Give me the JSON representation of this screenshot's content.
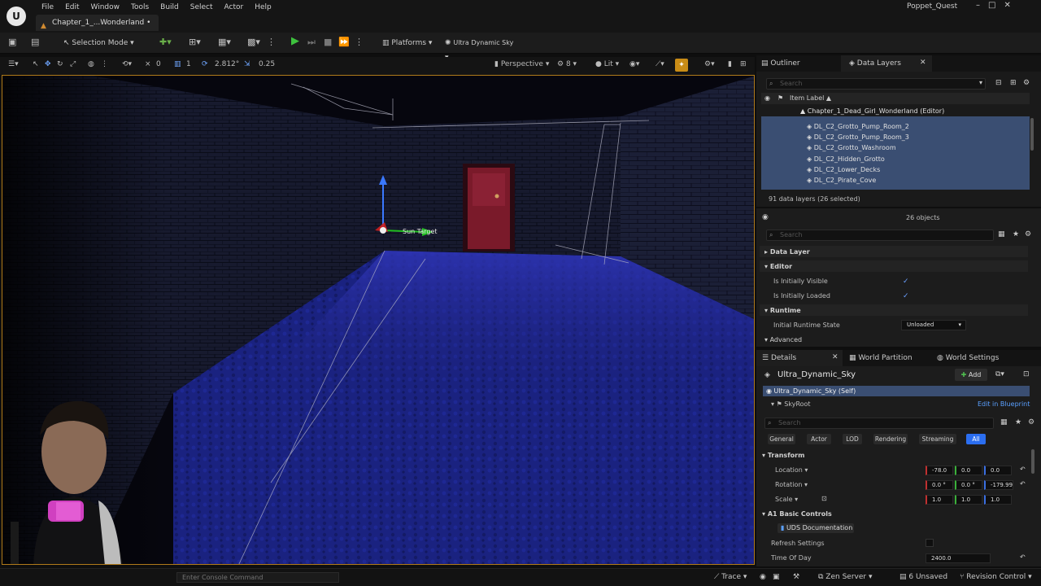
{
  "titlebar": {
    "menu": [
      "File",
      "Edit",
      "Window",
      "Tools",
      "Build",
      "Select",
      "Actor",
      "Help"
    ],
    "doc_tab": "Chapter_1_...Wonderland •",
    "project": "Poppet_Quest",
    "logo": "U",
    "window_controls": [
      "–",
      "□",
      "✕"
    ]
  },
  "toolbar": {
    "mode": "Selection Mode",
    "platforms": "Platforms",
    "sky": "Ultra Dynamic Sky"
  },
  "viewport_toolbar": {
    "grid_angle": "0",
    "grid_snap": "1",
    "move_speed": "2.812°",
    "scale_snap": "0.25",
    "view": "Perspective",
    "fov": "8",
    "lit": "Lit"
  },
  "viewport": {
    "gizmo_label": "Sun Target",
    "accent_border": "#b07a1a"
  },
  "console": {
    "placeholder": "Enter Console Command",
    "trace": "Trace",
    "zen": "Zen Server",
    "unsaved": "6 Unsaved",
    "revision": "Revision Control"
  },
  "data_layers": {
    "tab_outliner": "Outliner",
    "tab_layers": "Data Layers",
    "search_placeholder": "Search",
    "header": "Item Label ▲",
    "root": "Chapter_1_Dead_Girl_Wonderland (Editor)",
    "items": [
      "DL_C2_Grotto_Pump_Room_2",
      "DL_C2_Grotto_Pump_Room_3",
      "DL_C2_Grotto_Washroom",
      "DL_C2_Hidden_Grotto",
      "DL_C2_Lower_Decks",
      "DL_C2_Pirate_Cove"
    ],
    "summary": "91 data layers (26 selected)"
  },
  "layer_details": {
    "count": "26 objects",
    "search_placeholder": "Search",
    "sections": {
      "data_layer": "Data Layer",
      "editor": "Editor",
      "runtime": "Runtime",
      "advanced": "Advanced"
    },
    "initially_visible": "Is Initially Visible",
    "initially_loaded": "Is Initially Loaded",
    "runtime_state_label": "Initial Runtime State",
    "runtime_state_value": "Unloaded"
  },
  "details": {
    "tab_details": "Details",
    "tab_partition": "World Partition",
    "tab_settings": "World Settings",
    "actor_name": "Ultra_Dynamic_Sky",
    "add_label": "Add",
    "self_row": "Ultra_Dynamic_Sky (Self)",
    "sky_root": "SkyRoot",
    "edit_bp": "Edit in Blueprint",
    "search_placeholder": "Search",
    "categories": [
      "General",
      "Actor",
      "LOD",
      "Rendering",
      "Streaming",
      "All"
    ],
    "transform": "Transform",
    "location_label": "Location",
    "location": [
      "-78.0",
      "0.0",
      "0.0"
    ],
    "rotation_label": "Rotation",
    "rotation": [
      "0.0 °",
      "0.0 °",
      "-179.99"
    ],
    "scale_label": "Scale",
    "scale": [
      "1.0",
      "1.0",
      "1.0"
    ],
    "basic_controls": "Basic Controls",
    "basic_prefix": "A1",
    "uds_doc": "UDS Documentation",
    "refresh": "Refresh Settings",
    "time_label": "Time Of Day",
    "time_value": "2400.0"
  }
}
